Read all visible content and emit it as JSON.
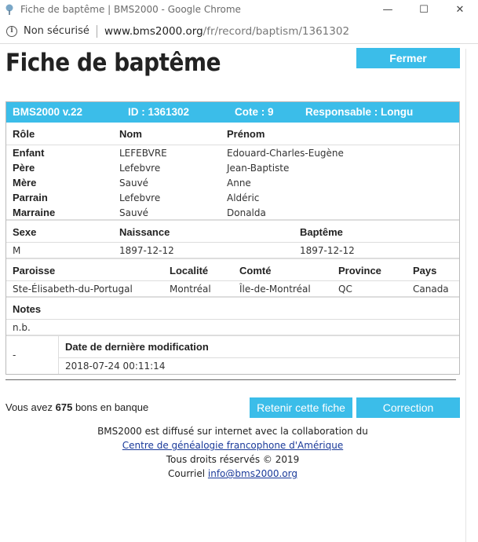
{
  "browser": {
    "title": "Fiche de baptême | BMS2000 - Google Chrome",
    "security": "Non sécurisé",
    "url_host": "www.bms2000.org",
    "url_path": "/fr/record/baptism/1361302"
  },
  "page": {
    "title": "Fiche de baptême",
    "close_label": "Fermer"
  },
  "record": {
    "header": {
      "version": "BMS2000 v.22",
      "id": "ID : 1361302",
      "cote": "Cote : 9",
      "responsable": "Responsable : Longu"
    },
    "roles_headers": [
      "Rôle",
      "Nom",
      "Prénom"
    ],
    "roles": [
      {
        "role": "Enfant",
        "nom": "LEFEBVRE",
        "prenom": "Edouard-Charles-Eugène"
      },
      {
        "role": "Père",
        "nom": "Lefebvre",
        "prenom": "Jean-Baptiste"
      },
      {
        "role": "Mère",
        "nom": "Sauvé",
        "prenom": "Anne"
      },
      {
        "role": "Parrain",
        "nom": "Lefebvre",
        "prenom": "Aldéric"
      },
      {
        "role": "Marraine",
        "nom": "Sauvé",
        "prenom": "Donalda"
      }
    ],
    "dates_headers": [
      "Sexe",
      "Naissance",
      "Baptême"
    ],
    "dates": {
      "sexe": "M",
      "naissance": "1897-12-12",
      "bapteme": "1897-12-12"
    },
    "place_headers": [
      "Paroisse",
      "Localité",
      "Comté",
      "Province",
      "Pays"
    ],
    "place": {
      "paroisse": "Ste-Élisabeth-du-Portugal",
      "localite": "Montréal",
      "comte": "Île-de-Montréal",
      "province": "QC",
      "pays": "Canada"
    },
    "notes_header": "Notes",
    "notes": "n.b.",
    "mod_flag": "-",
    "mod_header": "Date de dernière modification",
    "mod_date": "2018-07-24 00:11:14"
  },
  "bank": {
    "prefix": "Vous avez",
    "count": "675",
    "suffix": "bons en banque"
  },
  "actions": {
    "keep_label": "Retenir cette fiche",
    "correction_label": "Correction"
  },
  "footer": {
    "line1": "BMS2000 est diffusé sur internet avec la collaboration du",
    "link": "Centre de généalogie francophone d'Amérique",
    "rights": "Tous droits réservés © 2019",
    "mail_prefix": "Courriel",
    "mail": "info@bms2000.org"
  },
  "colors": {
    "accent": "#3bbde9",
    "link": "#1a3a9a"
  }
}
